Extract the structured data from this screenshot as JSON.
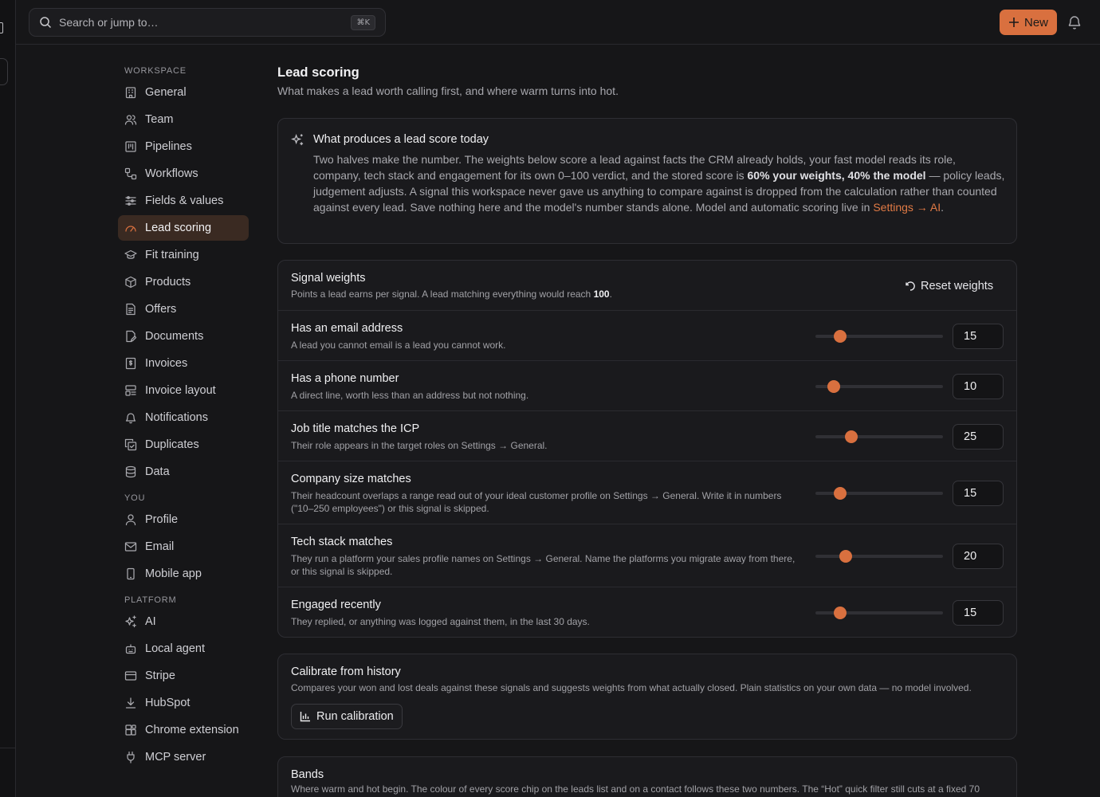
{
  "search": {
    "placeholder": "Search or jump to…",
    "shortcut": "⌘K"
  },
  "header": {
    "new_label": "New"
  },
  "sidebar": {
    "workspace_label": "WORKSPACE",
    "workspace_items": [
      {
        "label": "General",
        "icon": "building-icon"
      },
      {
        "label": "Team",
        "icon": "users-icon"
      },
      {
        "label": "Pipelines",
        "icon": "kanban-icon"
      },
      {
        "label": "Workflows",
        "icon": "workflow-icon"
      },
      {
        "label": "Fields & values",
        "icon": "sliders-icon"
      },
      {
        "label": "Lead scoring",
        "icon": "gauge-icon",
        "active": true
      },
      {
        "label": "Fit training",
        "icon": "graduation-cap-icon"
      },
      {
        "label": "Products",
        "icon": "package-icon"
      },
      {
        "label": "Offers",
        "icon": "file-text-icon"
      },
      {
        "label": "Documents",
        "icon": "file-edit-icon"
      },
      {
        "label": "Invoices",
        "icon": "receipt-icon"
      },
      {
        "label": "Invoice layout",
        "icon": "layout-icon"
      },
      {
        "label": "Notifications",
        "icon": "bell-icon"
      },
      {
        "label": "Duplicates",
        "icon": "copy-check-icon"
      },
      {
        "label": "Data",
        "icon": "database-icon"
      }
    ],
    "you_label": "YOU",
    "you_items": [
      {
        "label": "Profile",
        "icon": "user-icon"
      },
      {
        "label": "Email",
        "icon": "mail-icon"
      },
      {
        "label": "Mobile app",
        "icon": "smartphone-icon"
      }
    ],
    "platform_label": "PLATFORM",
    "platform_items": [
      {
        "label": "AI",
        "icon": "sparkles-icon"
      },
      {
        "label": "Local agent",
        "icon": "bot-icon"
      },
      {
        "label": "Stripe",
        "icon": "credit-card-icon"
      },
      {
        "label": "HubSpot",
        "icon": "download-icon"
      },
      {
        "label": "Chrome extension",
        "icon": "puzzle-icon"
      },
      {
        "label": "MCP server",
        "icon": "plug-icon"
      }
    ]
  },
  "page": {
    "title": "Lead scoring",
    "subtitle": "What makes a lead worth calling first, and where warm turns into hot."
  },
  "info": {
    "title": "What produces a lead score today",
    "text_1": "Two halves make the number. The weights below score a lead against facts the CRM already holds, your fast model reads its role, company, tech stack and engagement for its own 0–100 verdict, and the stored score is ",
    "text_bold": "60% your weights, 40% the model",
    "text_2": " — policy leads, judgement adjusts. A signal this workspace never gave us anything to compare against is dropped from the calculation rather than counted against every lead. Save nothing here and the model's number stands alone. Model and automatic scoring live in ",
    "link": "Settings → AI",
    "text_3": "."
  },
  "weights": {
    "title": "Signal weights",
    "subtitle_1": "Points a lead earns per signal. A lead matching everything would reach ",
    "max": "100",
    "subtitle_2": ".",
    "reset_label": "Reset weights",
    "slider_max": 100,
    "signals": [
      {
        "title": "Has an email address",
        "desc": "A lead you cannot email is a lead you cannot work.",
        "value": "15"
      },
      {
        "title": "Has a phone number",
        "desc": "A direct line, worth less than an address but not nothing.",
        "value": "10"
      },
      {
        "title": "Job title matches the ICP",
        "desc": "Their role appears in the target roles on Settings → General.",
        "value": "25"
      },
      {
        "title": "Company size matches",
        "desc": "Their headcount overlaps a range read out of your ideal customer profile on Settings → General. Write it in numbers (\"10–250 employees\") or this signal is skipped.",
        "value": "15"
      },
      {
        "title": "Tech stack matches",
        "desc": "They run a platform your sales profile names on Settings → General. Name the platforms you migrate away from there, or this signal is skipped.",
        "value": "20"
      },
      {
        "title": "Engaged recently",
        "desc": "They replied, or anything was logged against them, in the last 30 days.",
        "value": "15"
      }
    ]
  },
  "calibrate": {
    "title": "Calibrate from history",
    "desc": "Compares your won and lost deals against these signals and suggests weights from what actually closed. Plain statistics on your own data — no model involved.",
    "button": "Run calibration"
  },
  "bands": {
    "title": "Bands",
    "desc": "Where warm and hot begin. The colour of every score chip on the leads list and on a contact follows these two numbers. The “Hot” quick filter still cuts at a fixed 70"
  },
  "colors": {
    "accent": "#d9703f",
    "background": "#161618",
    "card": "#1a1a1d",
    "active_nav": "#3a2a22"
  }
}
